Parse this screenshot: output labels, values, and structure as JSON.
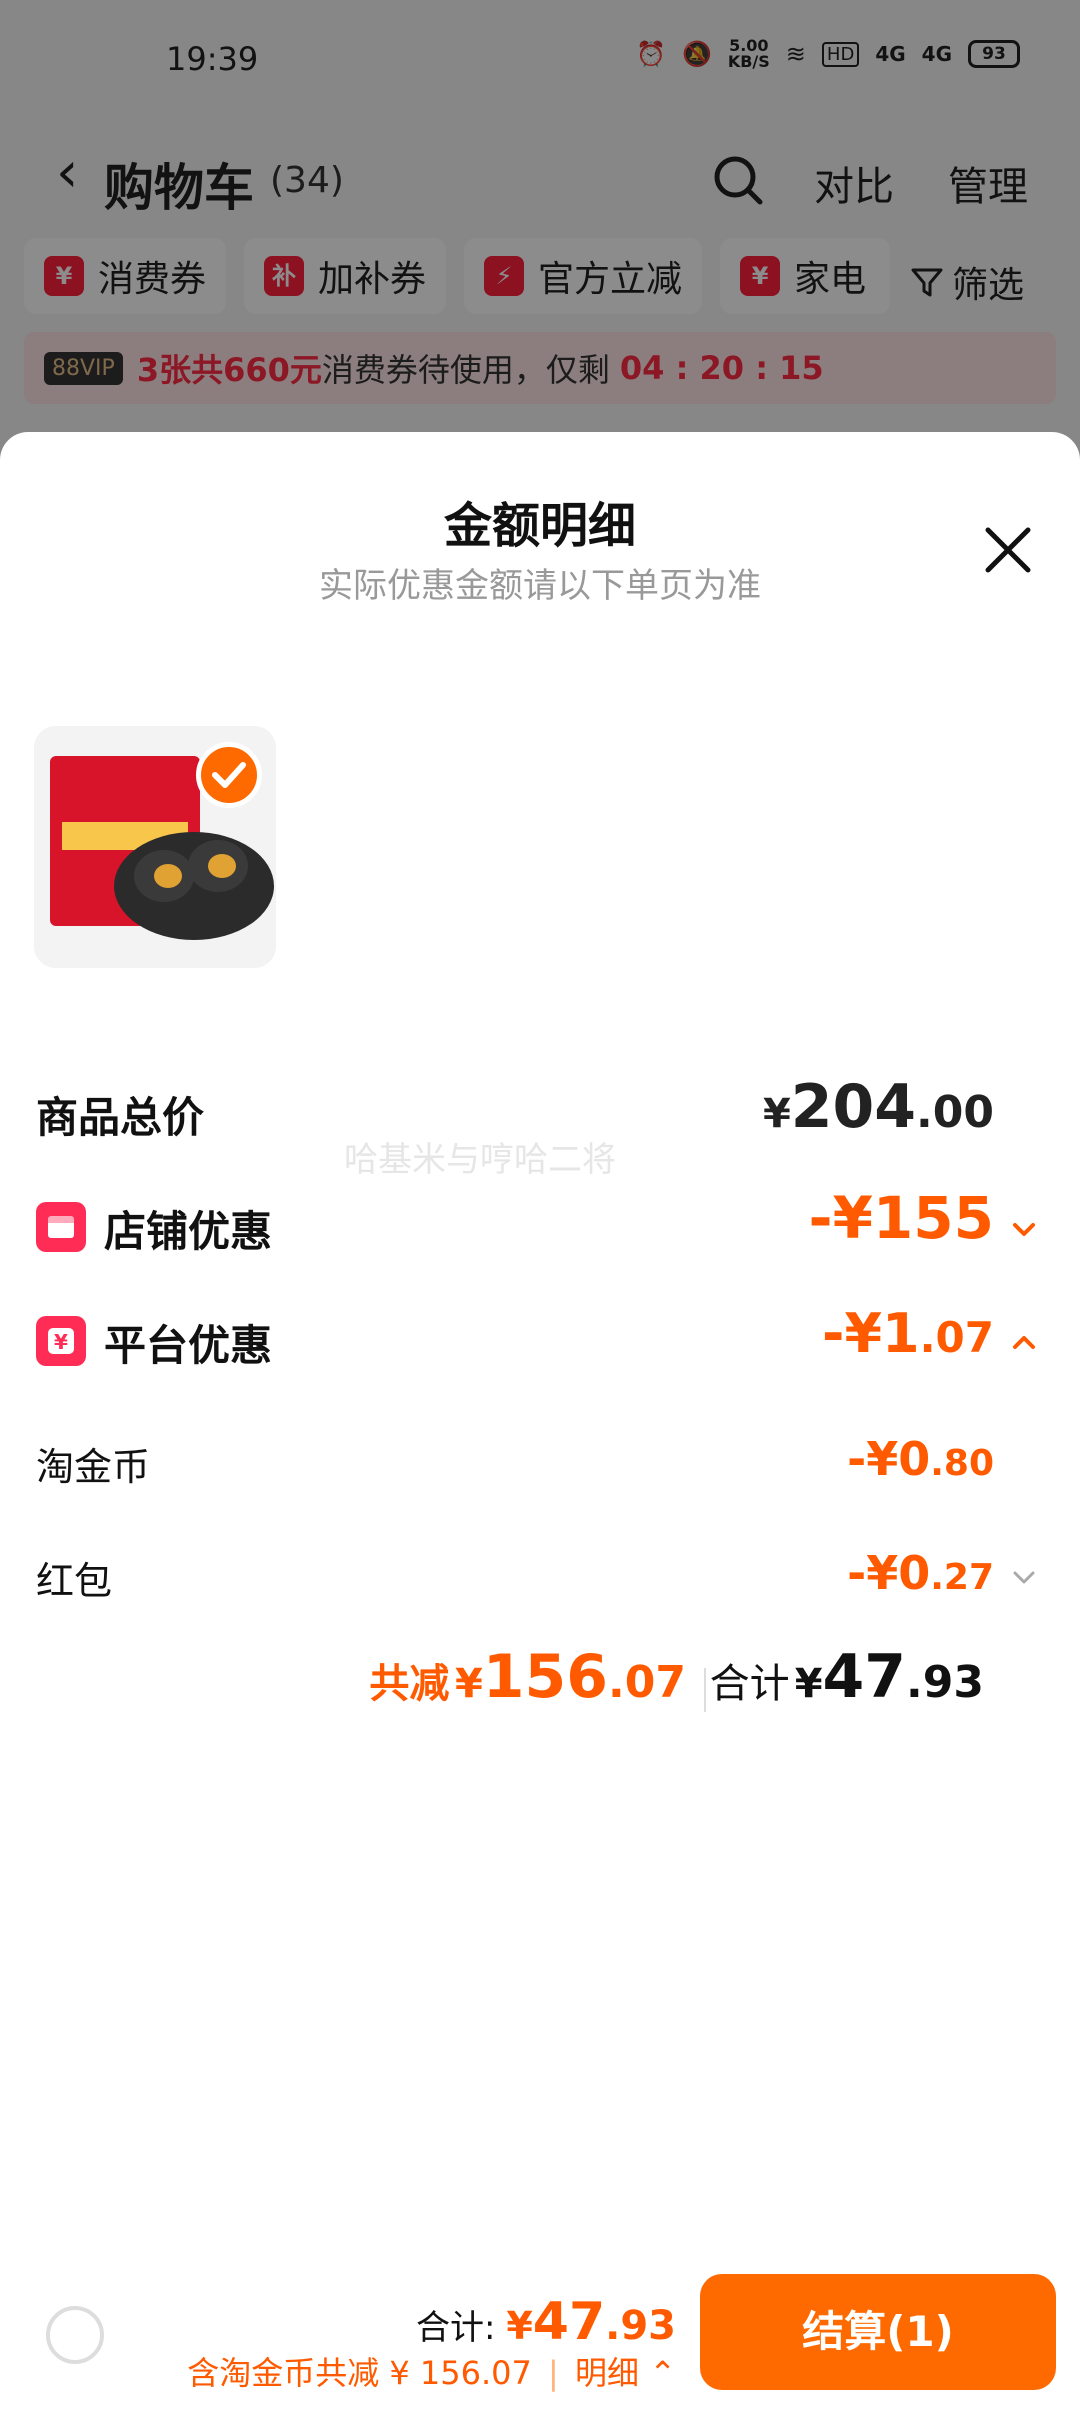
{
  "status_bar": {
    "time": "19:39",
    "net_speed_value": "5.00",
    "net_speed_unit": "KB/S",
    "signal_1": "4G",
    "signal_2": "4G",
    "battery": "93"
  },
  "nav": {
    "title": "购物车",
    "count": "(34)",
    "compare": "对比",
    "manage": "管理"
  },
  "chips": [
    {
      "icon": "¥",
      "label": "消费券"
    },
    {
      "icon": "补",
      "label": "加补券"
    },
    {
      "icon": "⚡",
      "label": "官方立减"
    },
    {
      "icon": "¥",
      "label": "家电"
    }
  ],
  "filter_label": "筛选",
  "promo": {
    "vip": "88VIP",
    "highlight": "3张共660元",
    "text": "消费券待使用，仅剩",
    "countdown": "04 : 20 : 15"
  },
  "sheet": {
    "title": "金额明细",
    "subtitle": "实际优惠金额请以下单页为准",
    "watermark": "哈基米与哼哈二将",
    "rows": {
      "subtotal": {
        "label": "商品总价",
        "currency": "¥",
        "main": "204",
        "dec": ".00"
      },
      "store": {
        "label": "店铺优惠",
        "value": "-¥155"
      },
      "platform": {
        "label": "平台优惠",
        "main": "-¥1",
        "dec": ".07"
      },
      "coin": {
        "label": "淘金币",
        "main": "-¥0",
        "dec": ".80"
      },
      "redpacket": {
        "label": "红包",
        "main": "-¥0",
        "dec": ".27"
      }
    },
    "summary": {
      "reduce_label": "共减",
      "reduce_currency": "¥",
      "reduce_main": "156",
      "reduce_dec": ".07",
      "total_label": "合计",
      "total_currency": "¥",
      "total_main": "47",
      "total_dec": ".93"
    }
  },
  "footer": {
    "total_label": "合计:",
    "total_currency": "¥",
    "total_main": "47",
    "total_dec": ".93",
    "note": "含淘金币共减 ¥ 156.07",
    "detail": "明细",
    "checkout": "结算(1)"
  },
  "colors": {
    "accent": "#ff6a00",
    "red": "#ff2d55",
    "discount": "#ff5a00"
  }
}
